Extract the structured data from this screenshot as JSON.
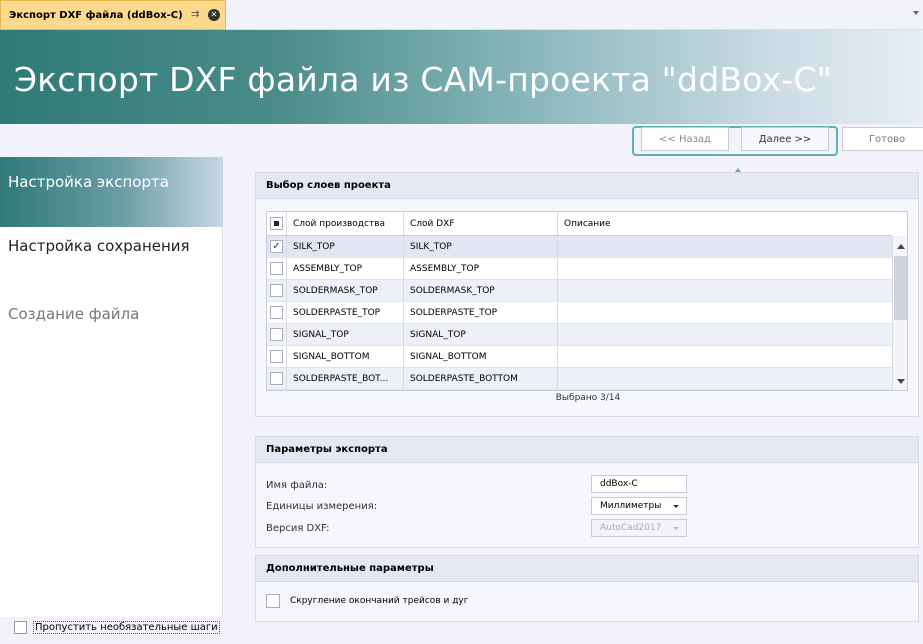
{
  "tab": {
    "title": "Экспорт DXF файла (ddBox-C)",
    "pin": "⇉",
    "close": "✕"
  },
  "banner": {
    "title": "Экспорт DXF файла из CAM-проекта \"ddBox-C\""
  },
  "nav": {
    "back": "<< Назад",
    "next": "Далее >>",
    "done": "Готово"
  },
  "steps": [
    "Настройка экспорта",
    "Настройка сохранения",
    "Создание файла"
  ],
  "skip_optional": "Пропустить необязательные шаги",
  "layers": {
    "header": "Выбор слоев проекта",
    "columns": [
      "Слой производства",
      "Слой DXF",
      "Описание"
    ],
    "rows": [
      {
        "prod": "SILK_TOP",
        "dxf": "SILK_TOP",
        "desc": "",
        "checked": "✓"
      },
      {
        "prod": "ASSEMBLY_TOP",
        "dxf": "ASSEMBLY_TOP",
        "desc": "",
        "checked": ""
      },
      {
        "prod": "SOLDERMASK_TOP",
        "dxf": "SOLDERMASK_TOP",
        "desc": "",
        "checked": ""
      },
      {
        "prod": "SOLDERPASTE_TOP",
        "dxf": "SOLDERPASTE_TOP",
        "desc": "",
        "checked": ""
      },
      {
        "prod": "SIGNAL_TOP",
        "dxf": "SIGNAL_TOP",
        "desc": "",
        "checked": ""
      },
      {
        "prod": "SIGNAL_BOTTOM",
        "dxf": "SIGNAL_BOTTOM",
        "desc": "",
        "checked": ""
      },
      {
        "prod": "SOLDERPASTE_BOT...",
        "dxf": "SOLDERPASTE_BOTTOM",
        "desc": "",
        "checked": ""
      }
    ],
    "selected_count": "Выбрано 3/14"
  },
  "export_params": {
    "header": "Параметры экспорта",
    "file_name_label": "Имя файла:",
    "file_name_value": "ddBox-C",
    "units_label": "Единицы измерения:",
    "units_value": "Миллиметры",
    "dxf_version_label": "Версия DXF:",
    "dxf_version_value": "AutoCad2017"
  },
  "extra_params": {
    "header": "Дополнительные параметры",
    "round_label": "Скругление окончаний трейсов и дуг"
  },
  "colors": {
    "accent": "#5fb0b5",
    "banner_start": "#2f7a78",
    "tab": "#fcd98c"
  }
}
